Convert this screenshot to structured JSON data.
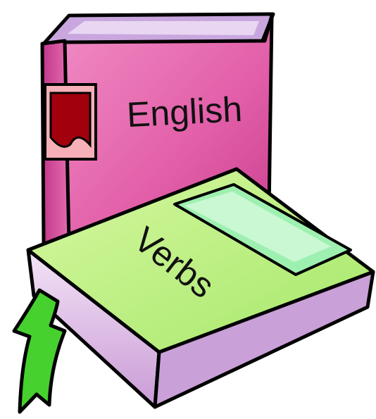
{
  "books": [
    {
      "title": "English",
      "cover_color": "#e05aa6",
      "label_color": "#b3000e"
    },
    {
      "title": "Verbs",
      "cover_color": "#b8f07a",
      "label_color": "#9ff0b0"
    }
  ],
  "colors": {
    "outline": "#000000",
    "pages": "#d9b4e4",
    "ribbon": "#3fcf2a"
  }
}
